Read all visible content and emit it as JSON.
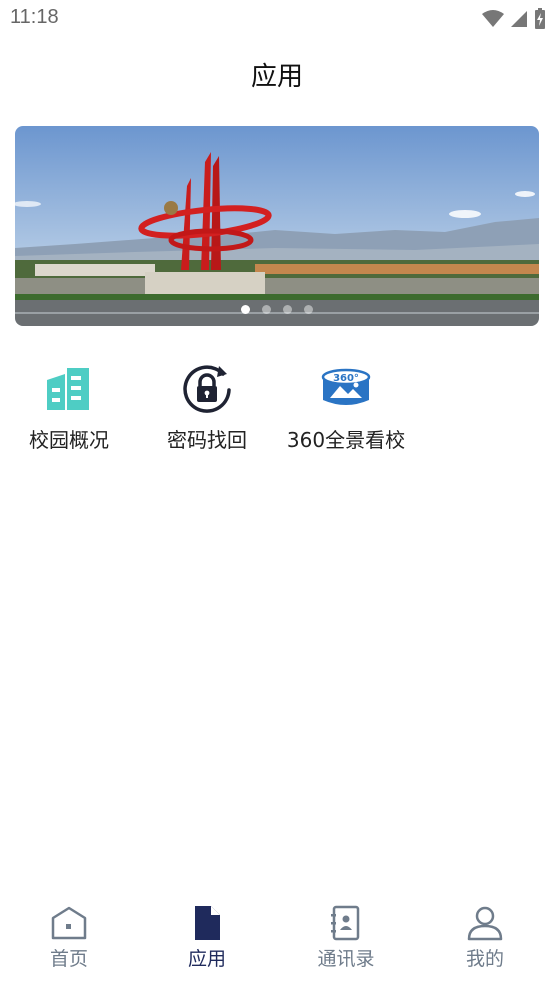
{
  "status_bar": {
    "time": "11:18"
  },
  "header": {
    "title": "应用"
  },
  "banner": {
    "slide_count": 4,
    "active_slide": 1
  },
  "apps": [
    {
      "label": "校园概况",
      "icon": "building-icon",
      "color": "#4ecdc4"
    },
    {
      "label": "密码找回",
      "icon": "lock-refresh-icon",
      "color": "#1f2333"
    },
    {
      "label": "360全景看校",
      "icon": "panorama-360-icon",
      "color": "#2a74c4"
    }
  ],
  "bottom_nav": {
    "items": [
      {
        "label": "首页",
        "icon": "home-icon"
      },
      {
        "label": "应用",
        "icon": "document-icon",
        "active": true
      },
      {
        "label": "通讯录",
        "icon": "contacts-book-icon"
      },
      {
        "label": "我的",
        "icon": "user-icon"
      }
    ]
  },
  "colors": {
    "nav_inactive": "#6f7c8b",
    "nav_active": "#1f2a5c",
    "accent_teal": "#4ecdc4",
    "accent_blue": "#2a74c4"
  }
}
